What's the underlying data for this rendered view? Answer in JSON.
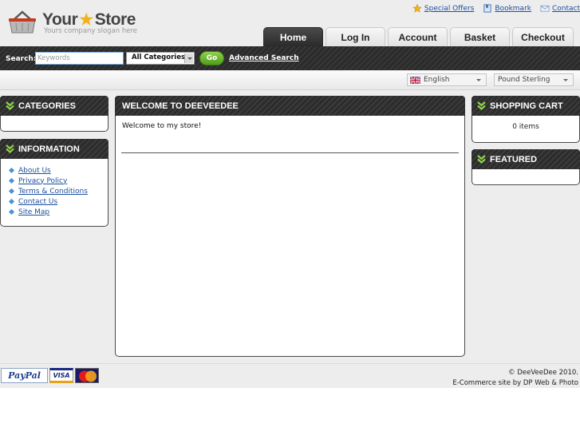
{
  "header": {
    "logo_word_1": "Your",
    "logo_word_2": "Store",
    "slogan": "Yours company slogan here",
    "toplinks": {
      "special_offers": "Special Offers",
      "bookmark": "Bookmark",
      "contact": "Contact"
    }
  },
  "tabs": [
    {
      "label": "Home",
      "active": true
    },
    {
      "label": "Log In"
    },
    {
      "label": "Account"
    },
    {
      "label": "Basket"
    },
    {
      "label": "Checkout"
    }
  ],
  "search": {
    "label": "Search:",
    "placeholder": "Keywords",
    "category_selected": "All Categories",
    "go_label": "Go",
    "advanced_label": "Advanced Search"
  },
  "options": {
    "language": "English",
    "currency": "Pound Sterling"
  },
  "left": {
    "categories_title": "CATEGORIES",
    "information_title": "INFORMATION",
    "info_links": [
      "About Us",
      "Privacy Policy",
      "Terms & Conditions",
      "Contact Us",
      "Site Map"
    ]
  },
  "center": {
    "title": "WELCOME TO DEEVEEDEE",
    "welcome_text": "Welcome to my store!"
  },
  "right": {
    "cart_title": "SHOPPING CART",
    "cart_count": "0 items",
    "featured_title": "FEATURED"
  },
  "footer": {
    "payment_logos": [
      "PayPal",
      "VISA",
      "MasterCard"
    ],
    "copyright": "© DeeVeeDee 2010.",
    "credit": "E-Commerce site by DP Web & Photo"
  },
  "colors": {
    "link": "#1b4f9e",
    "dark_bar": "#2b2b2b",
    "go_green": "#5aa624",
    "background": "#ededed"
  }
}
